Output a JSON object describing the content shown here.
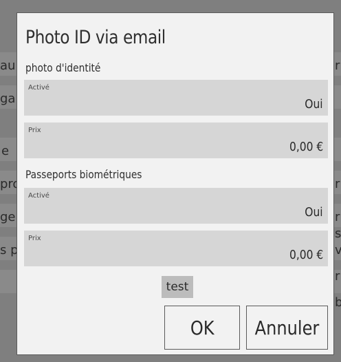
{
  "background": {
    "left_fragments": [
      "au",
      "ga",
      "e",
      "pro",
      "ge",
      "s p"
    ],
    "right_fragments": [
      "r",
      "r",
      "r",
      "s",
      "v",
      "r",
      "b"
    ]
  },
  "dialog": {
    "title": "Photo ID via email",
    "sections": [
      {
        "title": "photo d'identité",
        "fields": [
          {
            "label": "Activé",
            "value": "Oui"
          },
          {
            "label": "Prix",
            "value": "0,00 €"
          }
        ]
      },
      {
        "title": "Passeports biométriques",
        "fields": [
          {
            "label": "Activé",
            "value": "Oui"
          },
          {
            "label": "Prix",
            "value": "0,00 €"
          }
        ]
      }
    ],
    "test_label": "test",
    "ok_label": "OK",
    "cancel_label": "Annuler"
  },
  "colors": {
    "backdrop": "#7f7f7f",
    "dialog_background": "#f2f2f2",
    "field_background": "#d6d6d6",
    "test_button_background": "#bcbcbc",
    "border": "#5a5a5a"
  }
}
